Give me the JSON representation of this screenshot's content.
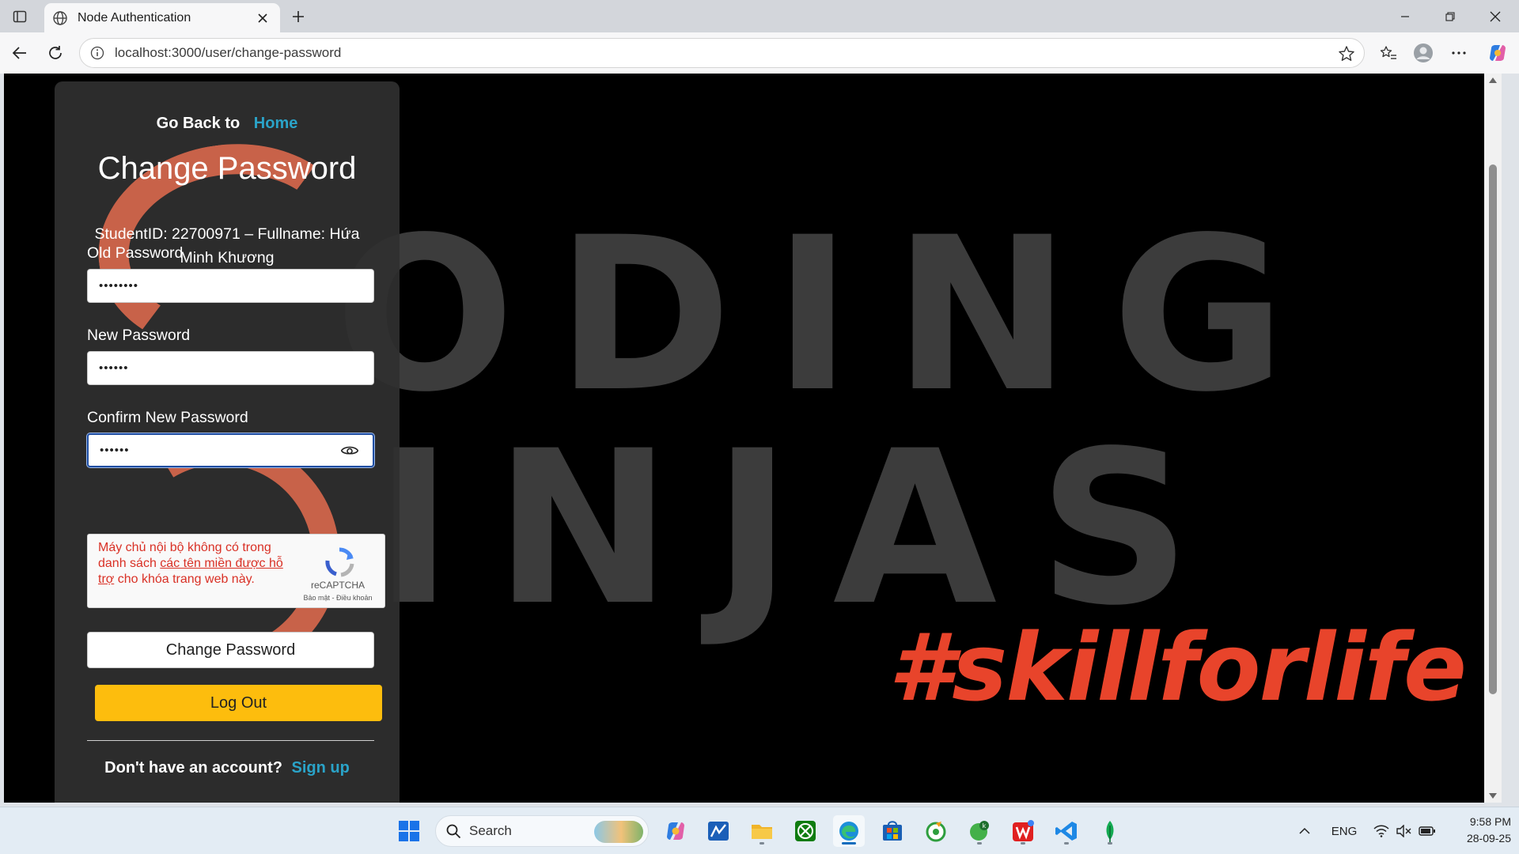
{
  "browser": {
    "tab_title": "Node Authentication",
    "url": "localhost:3000/user/change-password"
  },
  "page": {
    "background_text_line1": "ODING",
    "background_text_line2": "INJAS",
    "background_tagline": "#skillforlife",
    "goback_prefix": "Go Back to",
    "goback_link": "Home",
    "title": "Change Password",
    "student_info": "StudentID: 22700971 – Fullname: Hứa Minh Khương",
    "fields": [
      {
        "label": "Old Password",
        "value": "••••••••"
      },
      {
        "label": "New Password",
        "value": "••••••"
      },
      {
        "label": "Confirm New Password",
        "value": "••••••"
      }
    ],
    "recaptcha": {
      "msg_before": "Máy chủ nội bộ không có trong danh sách ",
      "msg_link": "các tên miền được hỗ trợ",
      "msg_after": " cho khóa trang web này.",
      "brand": "reCAPTCHA",
      "terms": "Bảo mật - Điều khoản"
    },
    "change_button": "Change Password",
    "logout_button": "Log Out",
    "signup_prefix": "Don't have an account?",
    "signup_link": "Sign up"
  },
  "taskbar": {
    "search_placeholder": "Search",
    "language": "ENG",
    "time": "9:58 PM",
    "date": "28-09-25"
  },
  "colors": {
    "link": "#2aa3c8",
    "logout_bg": "#fdbd0d",
    "tagline": "#e8442b",
    "error": "#d93025"
  }
}
